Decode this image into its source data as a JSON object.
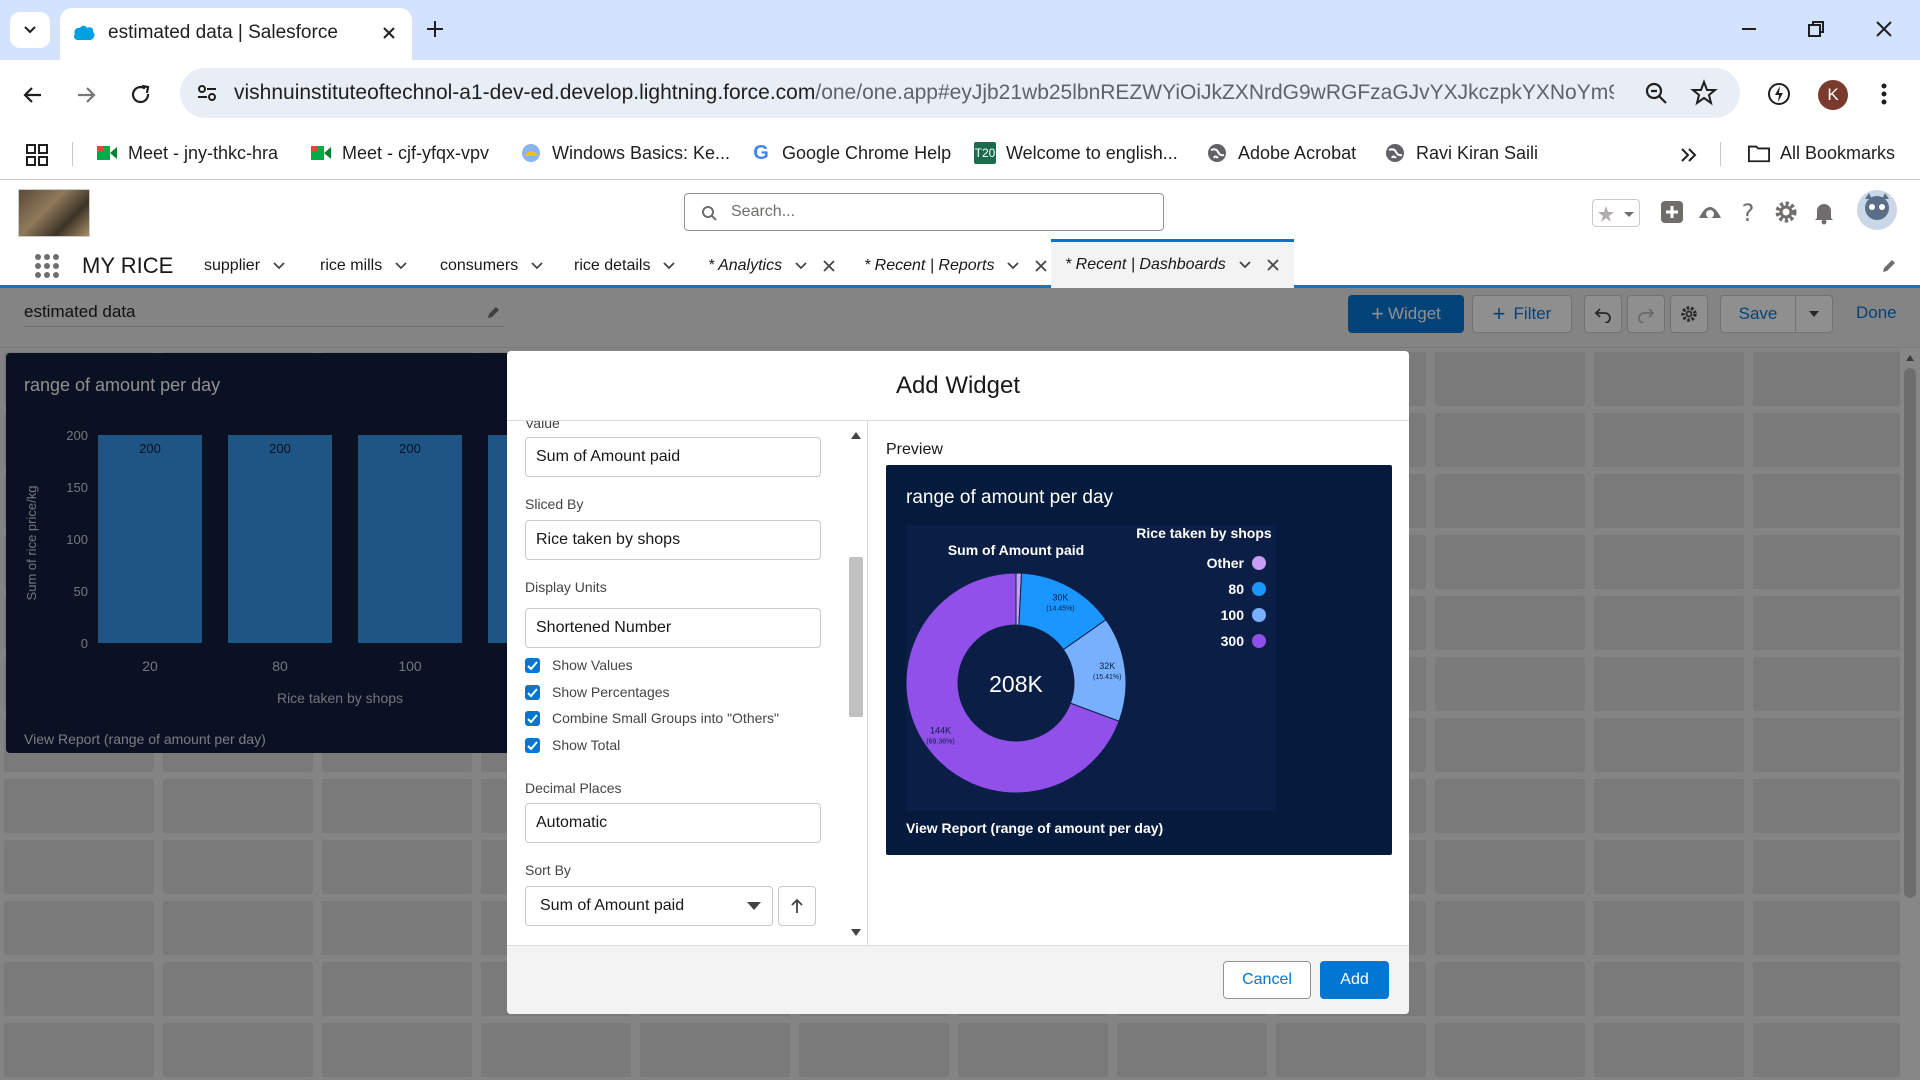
{
  "browser": {
    "tab_title": "estimated data | Salesforce",
    "url_host": "vishnuinstituteoftechnol-a1-dev-ed.develop.lightning.force.com",
    "url_path": "/one/one.app#eyJjb21wb25lbnREZWYiOiJkZXNrdG9wRGFzaGJvYXJkczpkYXNoYm9h...",
    "profile_initial": "K",
    "bookmarks": [
      "Meet - jny-thkc-hra",
      "Meet - cjf-yfqx-vpv",
      "Windows Basics: Ke...",
      "Google Chrome Help",
      "Welcome to english...",
      "Adobe Acrobat",
      "Ravi Kiran Saili"
    ],
    "all_bookmarks": "All Bookmarks"
  },
  "sf": {
    "search_placeholder": "Search...",
    "app_name": "MY RICE",
    "nav": [
      "supplier",
      "rice mills",
      "consumers",
      "rice details"
    ],
    "tabs": [
      "* Analytics",
      "* Recent | Reports",
      "* Recent | Dashboards"
    ]
  },
  "dashboard": {
    "name": "estimated data",
    "buttons": {
      "widget": "Widget",
      "filter": "Filter",
      "save": "Save",
      "done": "Done"
    },
    "widget": {
      "title": "range of amount per day",
      "link": "View Report (range of amount per day)"
    }
  },
  "modal": {
    "title": "Add Widget",
    "fields": {
      "value_label": "Value",
      "value": "Sum of Amount paid",
      "sliced_label": "Sliced By",
      "sliced": "Rice taken by shops",
      "units_label": "Display Units",
      "units": "Shortened Number",
      "decimal_label": "Decimal Places",
      "decimal": "Automatic",
      "sort_label": "Sort By",
      "sort": "Sum of Amount paid"
    },
    "checkboxes": [
      "Show Values",
      "Show Percentages",
      "Combine Small Groups into \"Others\"",
      "Show Total"
    ],
    "preview_label": "Preview",
    "cancel": "Cancel",
    "add": "Add"
  },
  "chart_data": [
    {
      "type": "bar",
      "title": "range of amount per day",
      "xlabel": "Rice taken by shops",
      "ylabel": "Sum of rice price/kg",
      "categories": [
        "20",
        "80",
        "100",
        ""
      ],
      "values": [
        200,
        200,
        200,
        200
      ],
      "ylim": [
        0,
        200
      ],
      "yticks": [
        0,
        50,
        100,
        150,
        200
      ],
      "color": "#3296ed",
      "background": "#0b1a3a"
    },
    {
      "type": "pie",
      "title": "range of amount per day",
      "measure": "Sum of Amount paid",
      "legend_title": "Rice taken by shops",
      "legend_placement": "top-right",
      "total": "208K",
      "slices": [
        {
          "name": "Other",
          "value_label": "",
          "percent": 0.8,
          "color": "#c79ef5"
        },
        {
          "name": "80",
          "value_label": "30K",
          "percent": 14.45,
          "color": "#1b96ff"
        },
        {
          "name": "100",
          "value_label": "32K",
          "percent": 15.41,
          "color": "#78b0fd"
        },
        {
          "name": "300",
          "value_label": "144K",
          "percent": 69.36,
          "color": "#9050e9"
        }
      ]
    }
  ]
}
